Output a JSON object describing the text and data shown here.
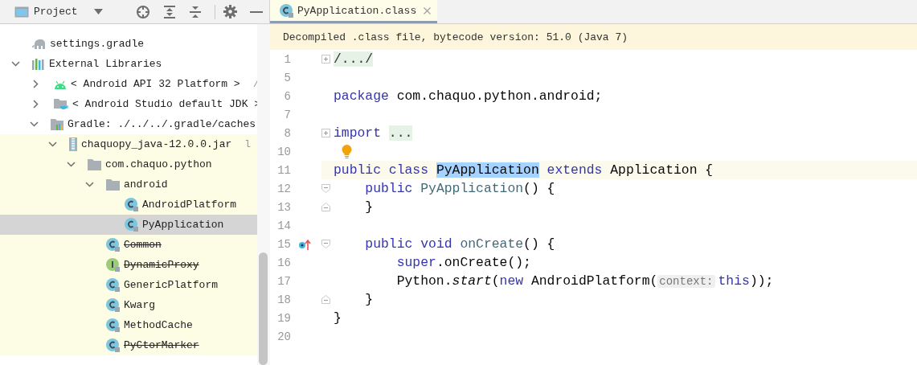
{
  "project_panel": {
    "title": "Project",
    "tree": [
      {
        "label": "settings.gradle",
        "kind": "gradle-file",
        "selected": false,
        "highlighted": false
      },
      {
        "label": "External Libraries",
        "kind": "libraries",
        "expanded": true,
        "selected": false,
        "highlighted": false,
        "children": [
          {
            "label": "< Android API 32 Platform >",
            "hint": "/",
            "kind": "android",
            "expanded": false,
            "selected": false,
            "highlighted": false
          },
          {
            "label": "< Android Studio default JDK >",
            "kind": "jdk",
            "expanded": false,
            "selected": false,
            "highlighted": false
          },
          {
            "label": "Gradle: ./../../.gradle/caches",
            "kind": "library",
            "expanded": true,
            "selected": false,
            "highlighted": false,
            "children": [
              {
                "label": "chaquopy_java-12.0.0.jar",
                "hint": "l",
                "kind": "jar",
                "expanded": true,
                "selected": false,
                "highlighted": true,
                "children": [
                  {
                    "label": "com.chaquo.python",
                    "kind": "package",
                    "expanded": true,
                    "selected": false,
                    "highlighted": true,
                    "children": [
                      {
                        "label": "android",
                        "kind": "package",
                        "expanded": true,
                        "selected": false,
                        "highlighted": true,
                        "children": [
                          {
                            "label": "AndroidPlatform",
                            "kind": "class",
                            "deprecated": false,
                            "selected": false,
                            "highlighted": true
                          },
                          {
                            "label": "PyApplication",
                            "kind": "class",
                            "deprecated": false,
                            "selected": true,
                            "highlighted": true
                          }
                        ]
                      },
                      {
                        "label": "Common",
                        "kind": "class",
                        "deprecated": true,
                        "selected": false,
                        "highlighted": true
                      },
                      {
                        "label": "DynamicProxy",
                        "kind": "interface",
                        "deprecated": true,
                        "selected": false,
                        "highlighted": true
                      },
                      {
                        "label": "GenericPlatform",
                        "kind": "class",
                        "deprecated": false,
                        "selected": false,
                        "highlighted": true
                      },
                      {
                        "label": "Kwarg",
                        "kind": "class",
                        "deprecated": false,
                        "selected": false,
                        "highlighted": true
                      },
                      {
                        "label": "MethodCache",
                        "kind": "class",
                        "deprecated": false,
                        "selected": false,
                        "highlighted": true
                      },
                      {
                        "label": "PyCtorMarker",
                        "kind": "class",
                        "deprecated": true,
                        "selected": false,
                        "highlighted": true
                      }
                    ]
                  }
                ]
              }
            ]
          }
        ]
      }
    ]
  },
  "editor": {
    "tabs": [
      {
        "label": "PyApplication.class",
        "selected": true
      }
    ],
    "banner": "Decompiled .class file, bytecode version: 51.0 (Java 7)",
    "lines": [
      {
        "number": "1",
        "current": false,
        "fold": {
          "kind": "expand"
        },
        "tokens": [
          {
            "kind": "folded",
            "text": "/.../"
          }
        ]
      },
      {
        "number": "5",
        "current": false
      },
      {
        "number": "6",
        "current": false,
        "tokens": [
          {
            "kind": "keyword",
            "text": "package"
          },
          {
            "kind": "plain",
            "text": " com.chaquo.python.android;"
          }
        ]
      },
      {
        "number": "7",
        "current": false
      },
      {
        "number": "8",
        "current": false,
        "fold": {
          "kind": "expand"
        },
        "tokens": [
          {
            "kind": "keyword",
            "text": "import"
          },
          {
            "kind": "space"
          },
          {
            "kind": "folded",
            "text": "..."
          }
        ]
      },
      {
        "number": "10",
        "current": false,
        "bulb": true
      },
      {
        "number": "11",
        "current": true,
        "tokens": [
          {
            "kind": "keyword",
            "text": "public"
          },
          {
            "kind": "space"
          },
          {
            "kind": "keyword",
            "text": "class"
          },
          {
            "kind": "space"
          },
          {
            "kind": "selection",
            "text": "PyApplication"
          },
          {
            "kind": "space"
          },
          {
            "kind": "keyword",
            "text": "extends"
          },
          {
            "kind": "plain",
            "text": " Application {"
          }
        ]
      },
      {
        "number": "12",
        "current": false,
        "fold": {
          "kind": "start"
        },
        "tokens": [
          {
            "kind": "indent"
          },
          {
            "kind": "keyword",
            "text": "public"
          },
          {
            "kind": "space"
          },
          {
            "kind": "declaration",
            "text": "PyApplication"
          },
          {
            "kind": "plain",
            "text": "() {"
          }
        ]
      },
      {
        "number": "13",
        "current": false,
        "fold": {
          "kind": "end"
        },
        "tokens": [
          {
            "kind": "indent"
          },
          {
            "kind": "plain",
            "text": "}"
          }
        ]
      },
      {
        "number": "14",
        "current": false
      },
      {
        "number": "15",
        "current": false,
        "fold": {
          "kind": "start"
        },
        "marker": {
          "kind": "override"
        },
        "tokens": [
          {
            "kind": "indent"
          },
          {
            "kind": "keyword",
            "text": "public"
          },
          {
            "kind": "space"
          },
          {
            "kind": "keyword",
            "text": "void"
          },
          {
            "kind": "space"
          },
          {
            "kind": "declaration",
            "text": "onCreate"
          },
          {
            "kind": "plain",
            "text": "() {"
          }
        ]
      },
      {
        "number": "16",
        "current": false,
        "tokens": [
          {
            "kind": "indent"
          },
          {
            "kind": "indent"
          },
          {
            "kind": "keyword",
            "text": "super"
          },
          {
            "kind": "plain",
            "text": ".onCreate();"
          }
        ]
      },
      {
        "number": "17",
        "current": false,
        "tokens": [
          {
            "kind": "indent"
          },
          {
            "kind": "indent"
          },
          {
            "kind": "plain",
            "text": "Python."
          },
          {
            "kind": "italic",
            "text": "start"
          },
          {
            "kind": "plain",
            "text": "("
          },
          {
            "kind": "keyword",
            "text": "new"
          },
          {
            "kind": "plain",
            "text": " AndroidPlatform("
          },
          {
            "kind": "hint",
            "text": "context:"
          },
          {
            "kind": "keyword",
            "text": "this"
          },
          {
            "kind": "plain",
            "text": "));"
          }
        ]
      },
      {
        "number": "18",
        "current": false,
        "fold": {
          "kind": "end"
        },
        "tokens": [
          {
            "kind": "indent"
          },
          {
            "kind": "plain",
            "text": "}"
          }
        ]
      },
      {
        "number": "19",
        "current": false,
        "tokens": [
          {
            "kind": "plain",
            "text": "}"
          }
        ]
      },
      {
        "number": "20",
        "current": false
      }
    ]
  }
}
